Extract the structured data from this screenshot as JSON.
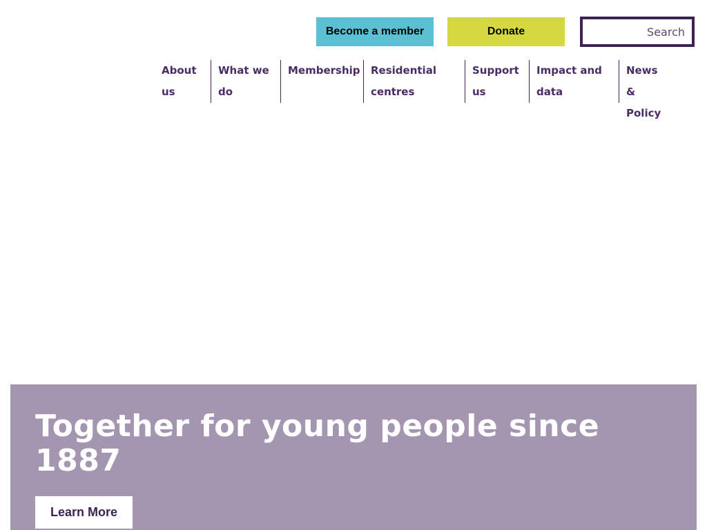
{
  "header": {
    "become_member_label": "Become a member",
    "donate_label": "Donate",
    "search": {
      "placeholder": "Search",
      "value": ""
    }
  },
  "nav": {
    "items": [
      {
        "label": "About us",
        "width": 81
      },
      {
        "label": "What we do",
        "width": 101
      },
      {
        "label": "Membership",
        "width": 120
      },
      {
        "label": "Residential centres",
        "width": 147
      },
      {
        "label": "Support us",
        "width": 93
      },
      {
        "label": "Impact and data",
        "width": 130
      },
      {
        "label": "News & Policy",
        "width": 80
      }
    ]
  },
  "hero": {
    "title": "Together for young people since 1887",
    "cta_label": "Learn More"
  },
  "colors": {
    "brand_purple": "#3d2354",
    "member_blue": "#5bc0d4",
    "donate_yellow": "#d5d940",
    "hero_bg": "#a495b1"
  }
}
